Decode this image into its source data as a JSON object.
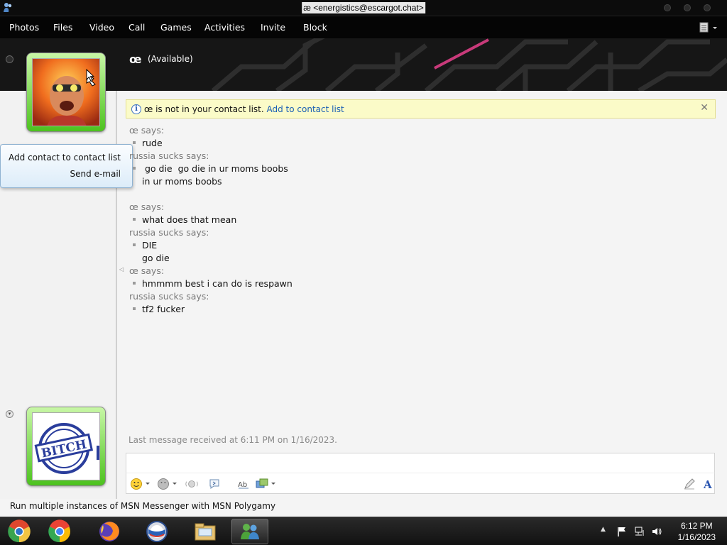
{
  "window": {
    "title": "æ <energistics@escargot.chat>"
  },
  "menu": {
    "items": [
      "Photos",
      "Files",
      "Video",
      "Call",
      "Games",
      "Activities",
      "Invite",
      "Block"
    ]
  },
  "header": {
    "contact_name": "œ",
    "status": "(Available)"
  },
  "context_menu": {
    "items": [
      "Add contact to contact list",
      "Send e-mail"
    ]
  },
  "infobar": {
    "text": "œ is not in your contact list.",
    "link": "Add to contact list",
    "close_icon": "close-x"
  },
  "conversation": {
    "blocks": [
      {
        "speaker": "œ says:",
        "lines": [
          "rude"
        ]
      },
      {
        "speaker": "russia sucks says:",
        "lines": [
          " go die  go die in ur moms boobs",
          "in ur moms boobs",
          ""
        ]
      },
      {
        "speaker": "œ says:",
        "lines": [
          "what does that mean"
        ]
      },
      {
        "speaker": "russia sucks says:",
        "lines": [
          "DIE",
          "go die"
        ]
      },
      {
        "speaker": "œ says:",
        "lines": [
          "hmmmm best i can do is respawn"
        ]
      },
      {
        "speaker": "russia sucks says:",
        "lines": [
          "tf2 fucker"
        ]
      }
    ]
  },
  "last_received": "Last message received at 6:11 PM on 1/16/2023.",
  "ad_line": "Run multiple instances of MSN Messenger with MSN Polygamy",
  "my_avatar_stamp": "BITCH",
  "toolbar": {
    "icons": [
      "emoticon-icon",
      "wink-icon",
      "nudge-icon",
      "voice-clip-icon",
      "handwriting-icon",
      "background-icon",
      "pen-icon",
      "font-icon"
    ]
  },
  "taskbar": {
    "apps": [
      "chrome-canary-icon",
      "chrome-icon",
      "firefox-icon",
      "opera-icon",
      "file-explorer-icon",
      "messenger-icon"
    ],
    "time": "6:12 PM",
    "date": "1/16/2023"
  },
  "colors": {
    "accent_green": "#4cc21e",
    "link_blue": "#1a5fb4",
    "infobar_yellow": "#fbfbc8"
  }
}
